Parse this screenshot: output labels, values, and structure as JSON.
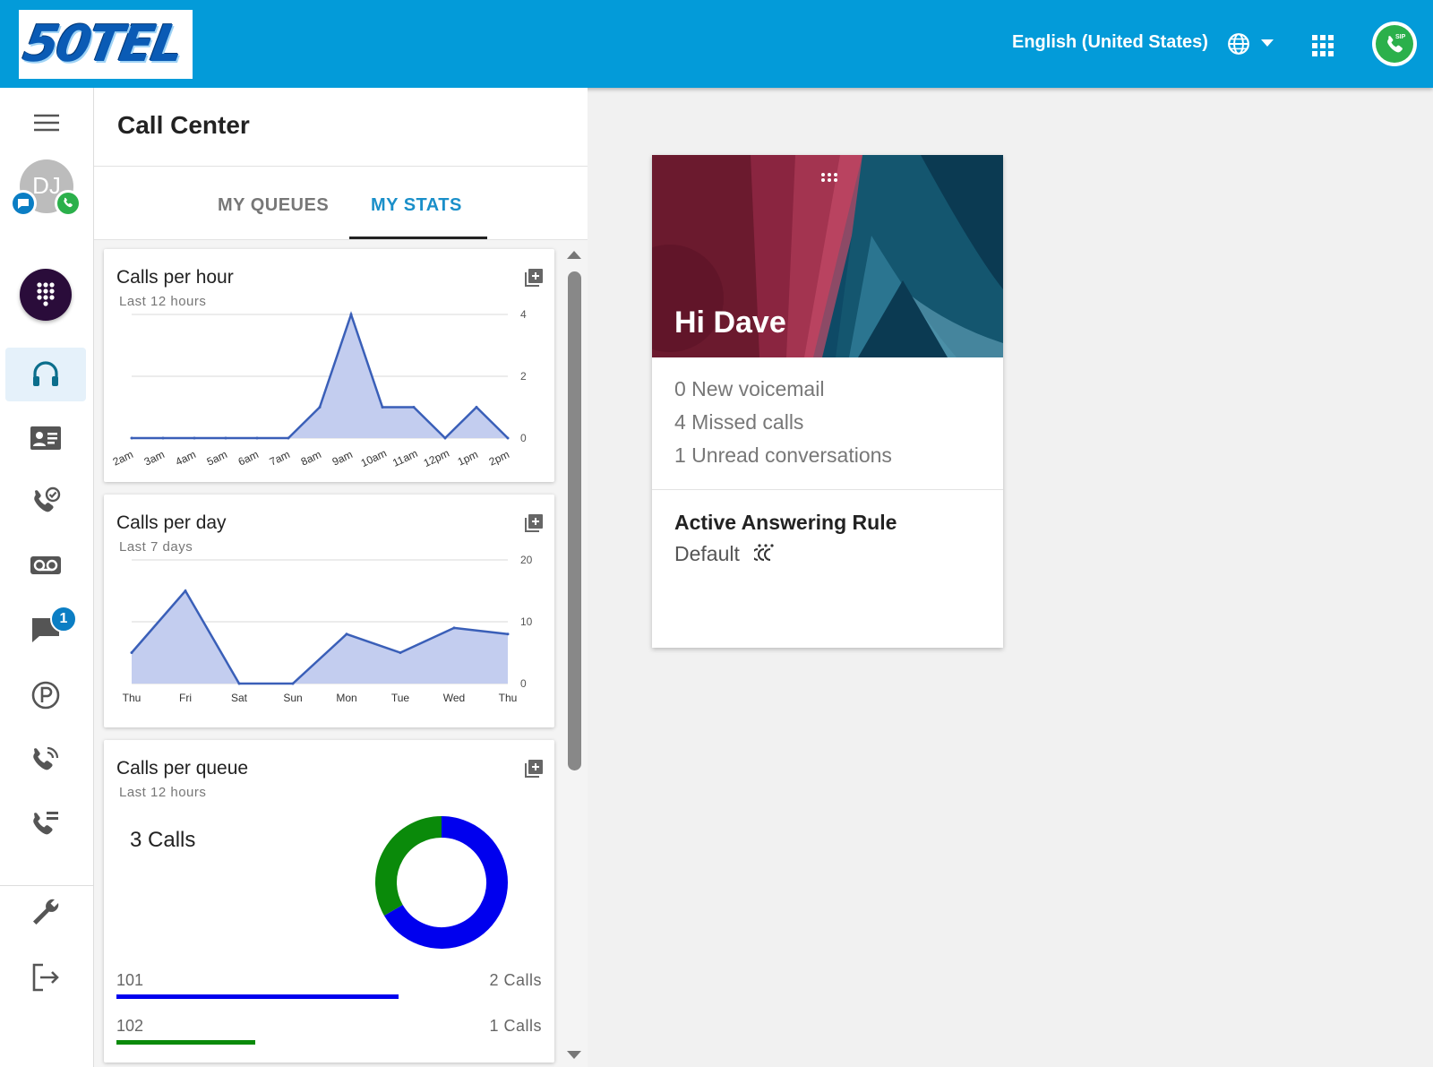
{
  "header": {
    "logo_text": "50TEL",
    "language": "English (United States)",
    "sip_label": "SIP",
    "icons": {
      "language": "globe-icon",
      "dropdown": "chevron-down-icon",
      "apps": "apps-grid-icon",
      "sip_phone": "phone-icon"
    },
    "colors": {
      "bar": "#039bd9",
      "sip": "#2bb04b"
    }
  },
  "nav": {
    "avatar_initials": "DJ",
    "messages_badge": "1",
    "items": [
      {
        "icon": "menu-icon"
      },
      {
        "icon": "dialpad-icon"
      },
      {
        "icon": "headset-icon",
        "active": true
      },
      {
        "icon": "contacts-icon"
      },
      {
        "icon": "call-history-icon"
      },
      {
        "icon": "voicemail-icon"
      },
      {
        "icon": "chat-icon"
      },
      {
        "icon": "parking-icon"
      },
      {
        "icon": "ringing-phone-icon"
      },
      {
        "icon": "call-forward-icon"
      },
      {
        "icon": "wrench-icon"
      },
      {
        "icon": "logout-icon"
      }
    ]
  },
  "page": {
    "title": "Call Center",
    "tabs": [
      {
        "label": "MY QUEUES",
        "active": false
      },
      {
        "label": "MY STATS",
        "active": true
      }
    ]
  },
  "cards": {
    "per_hour": {
      "title": "Calls per hour",
      "subtitle": "Last 12 hours"
    },
    "per_day": {
      "title": "Calls per day",
      "subtitle": "Last 7 days"
    },
    "per_queue": {
      "title": "Calls per queue",
      "subtitle": "Last 12 hours",
      "total": "3 Calls",
      "queues": [
        {
          "name": "101",
          "calls": "2 Calls",
          "color": "#0000ee",
          "fraction": 0.67
        },
        {
          "name": "102",
          "calls": "1 Calls",
          "color": "#0a8a0a",
          "fraction": 0.33
        }
      ]
    }
  },
  "chart_data": [
    {
      "type": "area",
      "title": "Calls per hour",
      "subtitle": "Last 12 hours",
      "categories": [
        "2am",
        "3am",
        "4am",
        "5am",
        "6am",
        "7am",
        "8am",
        "9am",
        "10am",
        "11am",
        "12pm",
        "1pm",
        "2pm"
      ],
      "values": [
        0,
        0,
        0,
        0,
        0,
        0,
        1,
        4,
        1,
        1,
        0,
        1,
        0
      ],
      "ylim": [
        0,
        4
      ],
      "yticks": [
        0,
        2,
        4
      ],
      "grid": true,
      "color": "#3a5fb8",
      "fill": "#c3cdef"
    },
    {
      "type": "area",
      "title": "Calls per day",
      "subtitle": "Last 7 days",
      "categories": [
        "Thu",
        "Fri",
        "Sat",
        "Sun",
        "Mon",
        "Tue",
        "Wed",
        "Thu"
      ],
      "values": [
        5,
        15,
        0,
        0,
        8,
        5,
        9,
        8
      ],
      "ylim": [
        0,
        20
      ],
      "yticks": [
        0,
        10,
        20
      ],
      "grid": true,
      "color": "#3a5fb8",
      "fill": "#c3cdef"
    },
    {
      "type": "pie",
      "title": "Calls per queue",
      "subtitle": "Last 12 hours",
      "categories": [
        "101",
        "102"
      ],
      "values": [
        2,
        1
      ],
      "colors": [
        "#0000ee",
        "#0a8a0a"
      ]
    }
  ],
  "welcome": {
    "greeting": "Hi Dave",
    "lines": [
      "0 New voicemail",
      "4 Missed calls",
      "1 Unread conversations"
    ],
    "rule_title": "Active Answering Rule",
    "rule_value": "Default"
  }
}
